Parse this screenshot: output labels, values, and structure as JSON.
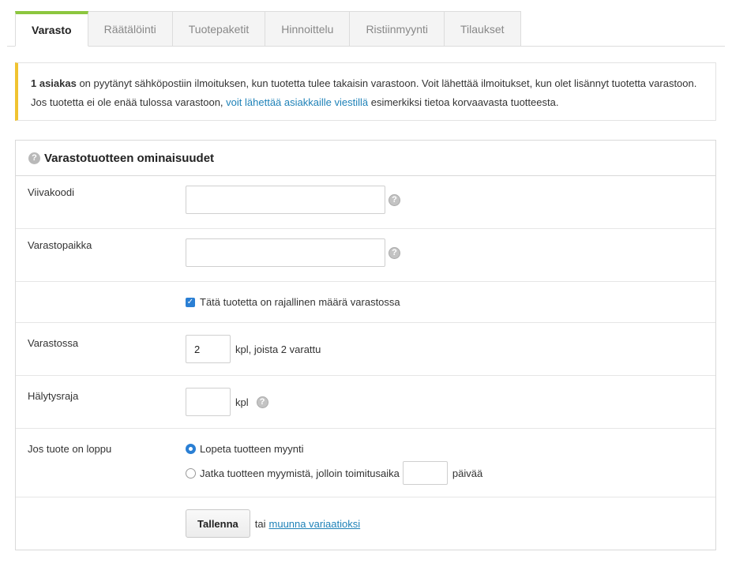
{
  "tabs": [
    {
      "label": "Varasto",
      "active": true
    },
    {
      "label": "Räätälöinti",
      "active": false
    },
    {
      "label": "Tuotepaketit",
      "active": false
    },
    {
      "label": "Hinnoittelu",
      "active": false
    },
    {
      "label": "Ristiinmyynti",
      "active": false
    },
    {
      "label": "Tilaukset",
      "active": false
    }
  ],
  "notice": {
    "bold": "1 asiakas",
    "text1": " on pyytänyt sähköpostiin ilmoituksen, kun tuotetta tulee takaisin varastoon. Voit lähettää ilmoitukset, kun olet lisännyt tuotetta varastoon. Jos tuotetta ei ole enää tulossa varastoon, ",
    "link": "voit lähettää asiakkaille viestillä",
    "text2": " esimerkiksi tietoa korvaavasta tuotteesta.",
    "accent_color": "#f0c330"
  },
  "panel": {
    "title": "Varastotuotteen ominaisuudet",
    "barcode": {
      "label": "Viivakoodi",
      "value": ""
    },
    "location": {
      "label": "Varastopaikka",
      "value": ""
    },
    "limited": {
      "label": "Tätä tuotetta on rajallinen määrä varastossa",
      "checked": true
    },
    "stock": {
      "label": "Varastossa",
      "value": "2",
      "suffix": "kpl, joista 2 varattu"
    },
    "alert": {
      "label": "Hälytysraja",
      "value": "",
      "suffix": "kpl"
    },
    "soldout": {
      "label": "Jos tuote on loppu",
      "option1": "Lopeta tuotteen myynti",
      "option2": "Jatka tuotteen myymistä, jolloin toimitusaika",
      "days_value": "",
      "days_suffix": "päivää",
      "selected": 1
    },
    "actions": {
      "save": "Tallenna",
      "or": "tai",
      "link": "muunna variaatioksi"
    }
  },
  "icons": {
    "help": "question-circle-icon",
    "check": "checkmark-icon"
  },
  "colors": {
    "tab_active": "#8cc63f",
    "link": "#1f82b8",
    "checkbox": "#2a7fd4"
  }
}
